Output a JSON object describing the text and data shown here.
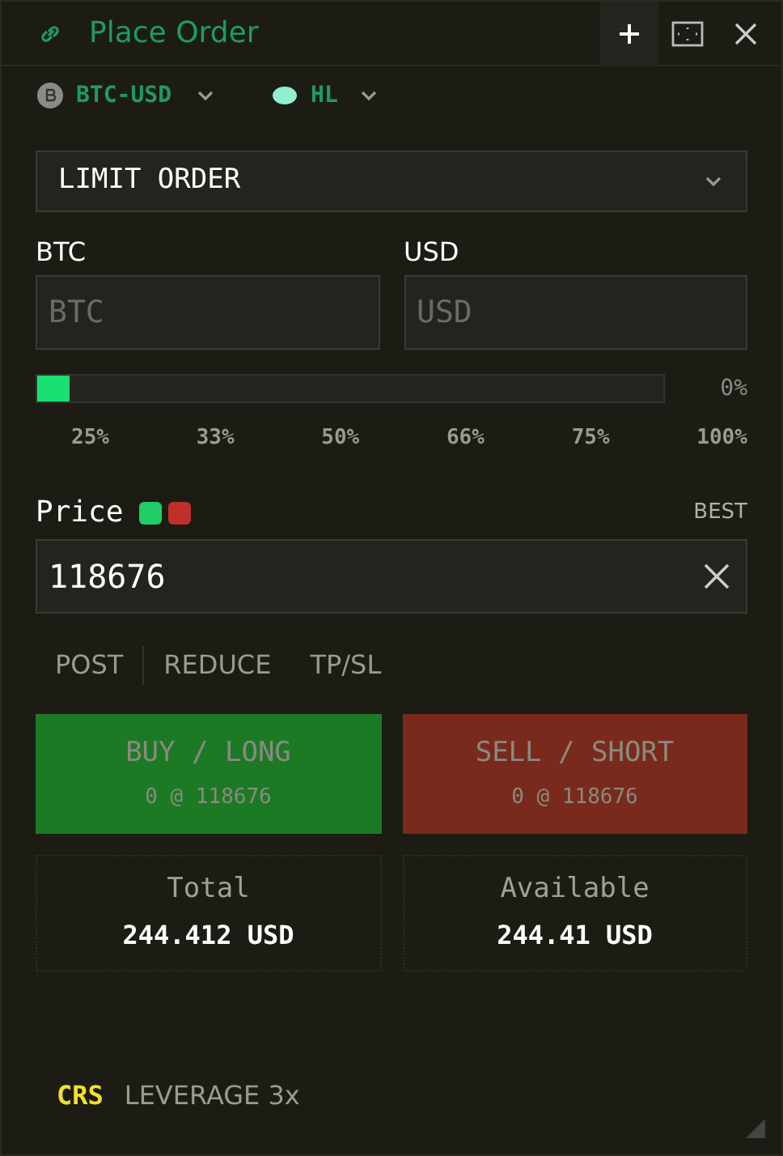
{
  "window": {
    "title": "Place Order"
  },
  "pair": {
    "symbol": "BTC-USD",
    "exchange": "HL"
  },
  "order_type": {
    "value": "LIMIT ORDER"
  },
  "amount_fields": [
    {
      "label": "BTC",
      "placeholder": "BTC"
    },
    {
      "label": "USD",
      "placeholder": "USD"
    }
  ],
  "size_slider": {
    "level": 0,
    "reading": "0%"
  },
  "presets": [
    "25%",
    "33%",
    "50%",
    "66%",
    "75%",
    "100%"
  ],
  "price": {
    "label": "Price",
    "dots": [
      {
        "color": "#22cc66"
      },
      {
        "color": "#c0302a"
      }
    ],
    "best": "BEST",
    "value": "118676"
  },
  "toggles": [
    "POST",
    "REDUCE",
    "TP/SL"
  ],
  "actions": [
    {
      "kind": "buy",
      "label": "BUY / LONG",
      "detail": "0 @ 118676",
      "disabled": true
    },
    {
      "kind": "sell",
      "label": "SELL / SHORT",
      "detail": "0 @ 118676",
      "disabled": true
    }
  ],
  "balances": [
    {
      "label": "Total",
      "value": "244.412 USD"
    },
    {
      "label": "Available",
      "value": "244.41 USD"
    }
  ],
  "footer": {
    "margin_mode": "CRS",
    "leverage": "LEVERAGE 3x"
  }
}
